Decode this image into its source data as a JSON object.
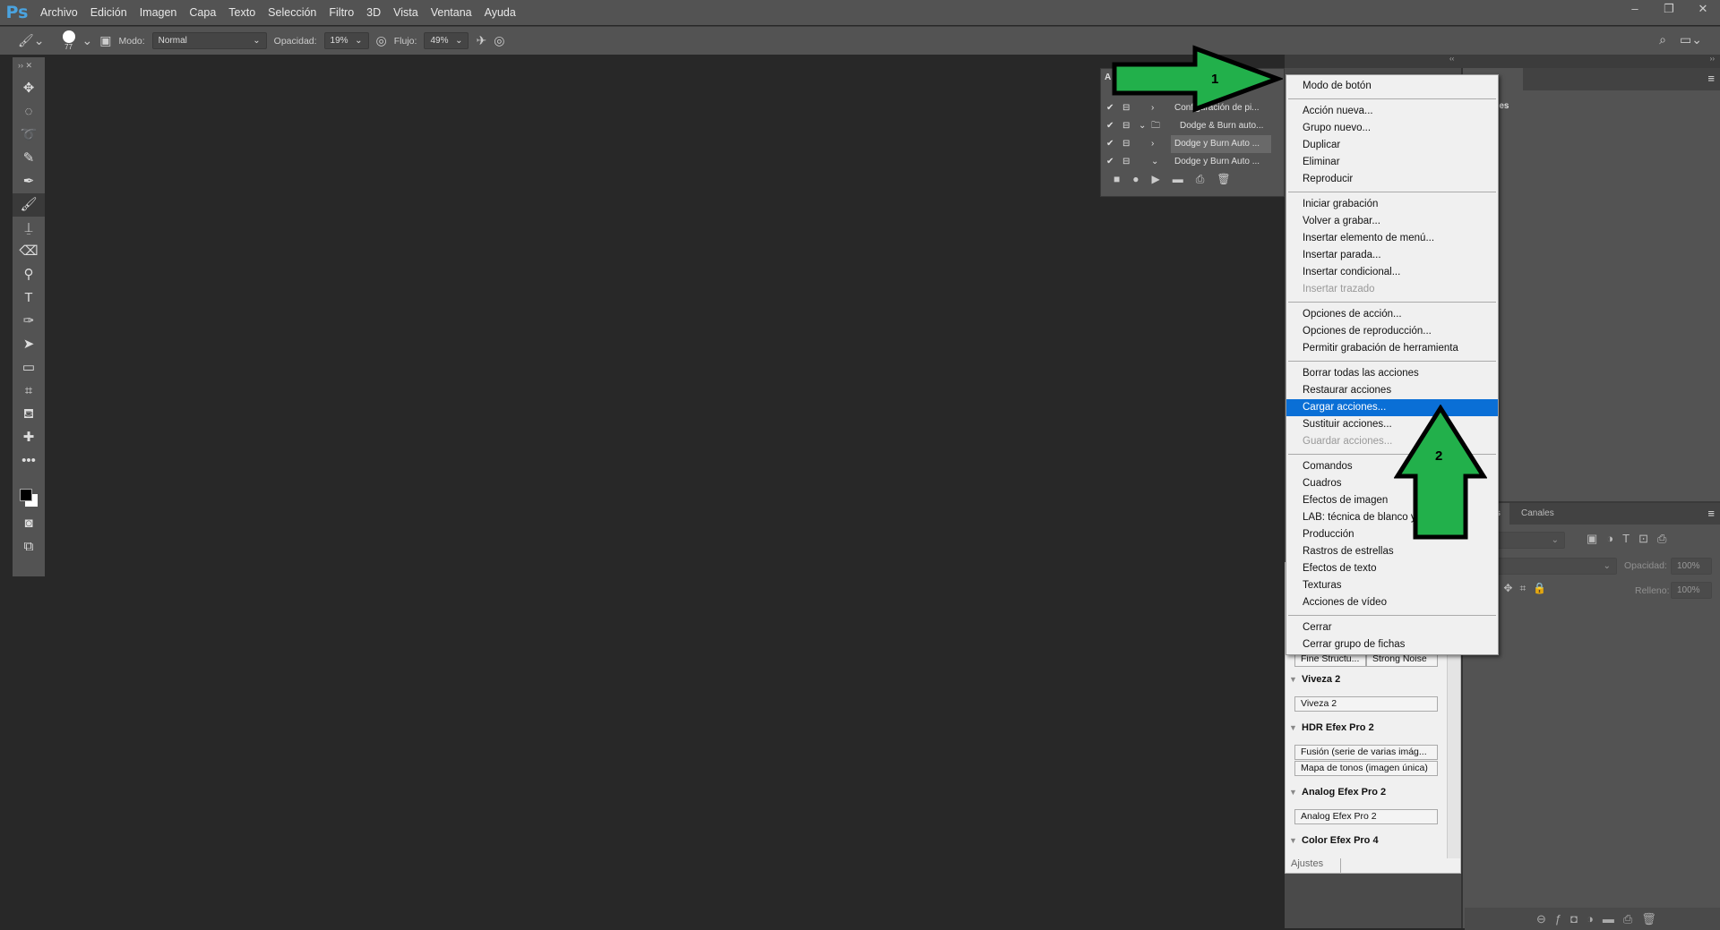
{
  "app": {
    "logo": "Ps",
    "menu": [
      "Archivo",
      "Edición",
      "Imagen",
      "Capa",
      "Texto",
      "Selección",
      "Filtro",
      "3D",
      "Vista",
      "Ventana",
      "Ayuda"
    ],
    "window_controls": [
      "minimize",
      "restore",
      "close"
    ]
  },
  "options": {
    "brush_size": "77",
    "mode_label": "Modo:",
    "mode_value": "Normal",
    "opacity_label": "Opacidad:",
    "opacity_value": "19%",
    "flow_label": "Flujo:",
    "flow_value": "49%"
  },
  "tools": [
    "move",
    "marquee",
    "lasso",
    "quick-select",
    "eyedropper",
    "brush",
    "stamp",
    "eraser",
    "dodge",
    "type",
    "pen",
    "path-select",
    "rectangle",
    "crop",
    "paint-bucket",
    "healing",
    "more"
  ],
  "actions_panel": {
    "title": "A",
    "rows": [
      {
        "checked": true,
        "expand": "›",
        "folder": false,
        "name": "Configuración de pi..."
      },
      {
        "checked": true,
        "expand": "⌄",
        "folder": true,
        "name": "Dodge & Burn auto..."
      },
      {
        "checked": true,
        "expand": "›",
        "folder": false,
        "name": "Dodge y Burn Auto ...",
        "selected": true
      },
      {
        "checked": true,
        "expand": "⌄",
        "folder": false,
        "name": "Dodge y Burn Auto ..."
      }
    ]
  },
  "context_menu": {
    "groups": [
      [
        {
          "label": "Modo de botón"
        }
      ],
      [
        {
          "label": "Acción nueva..."
        },
        {
          "label": "Grupo nuevo..."
        },
        {
          "label": "Duplicar"
        },
        {
          "label": "Eliminar"
        },
        {
          "label": "Reproducir"
        }
      ],
      [
        {
          "label": "Iniciar grabación"
        },
        {
          "label": "Volver a grabar..."
        },
        {
          "label": "Insertar elemento de menú..."
        },
        {
          "label": "Insertar parada..."
        },
        {
          "label": "Insertar condicional..."
        },
        {
          "label": "Insertar trazado",
          "disabled": true
        }
      ],
      [
        {
          "label": "Opciones de acción..."
        },
        {
          "label": "Opciones de reproducción..."
        },
        {
          "label": "Permitir grabación de herramienta"
        }
      ],
      [
        {
          "label": "Borrar todas las acciones"
        },
        {
          "label": "Restaurar acciones"
        },
        {
          "label": "Cargar acciones...",
          "highlighted": true
        },
        {
          "label": "Sustituir acciones..."
        },
        {
          "label": "Guardar acciones...",
          "disabled": true
        }
      ],
      [
        {
          "label": "Comandos"
        },
        {
          "label": "Cuadros"
        },
        {
          "label": "Efectos de imagen"
        },
        {
          "label": "LAB: técnica de blanco y"
        },
        {
          "label": "Producción"
        },
        {
          "label": "Rastros de estrellas"
        },
        {
          "label": "Efectos de texto"
        },
        {
          "label": "Texturas"
        },
        {
          "label": "Acciones de vídeo"
        }
      ],
      [
        {
          "label": "Cerrar"
        },
        {
          "label": "Cerrar grupo de fichas"
        }
      ]
    ]
  },
  "properties_panel": {
    "tab": "edades",
    "subtitle": "opiedades"
  },
  "layers_panel": {
    "tabs": [
      "Capas",
      "Canales"
    ],
    "kind_value": "o",
    "blend_value": "l",
    "opacity_label": "Opacidad:",
    "opacity_value": "100%",
    "fill_label": "Relleno:",
    "fill_value": "100%"
  },
  "nik_panel": {
    "buttons_top": [
      "Fine Structu...",
      "Strong Noise"
    ],
    "sections": [
      {
        "title": "Viveza 2",
        "buttons": [
          "Viveza 2"
        ]
      },
      {
        "title": "HDR Efex Pro 2",
        "buttons": [
          "Fusión (serie de varias imág...",
          "Mapa de tonos (imagen única)"
        ]
      },
      {
        "title": "Analog Efex Pro 2",
        "buttons": [
          "Analog Efex Pro 2"
        ]
      },
      {
        "title": "Color Efex Pro 4",
        "buttons": []
      }
    ],
    "tab": "Ajustes"
  },
  "annotations": [
    {
      "label": "1",
      "direction": "right"
    },
    {
      "label": "2",
      "direction": "up"
    }
  ],
  "colors": {
    "highlight": "#0a6fd6",
    "arrow": "#22b04b",
    "panel": "#535353",
    "canvas": "#282828"
  }
}
